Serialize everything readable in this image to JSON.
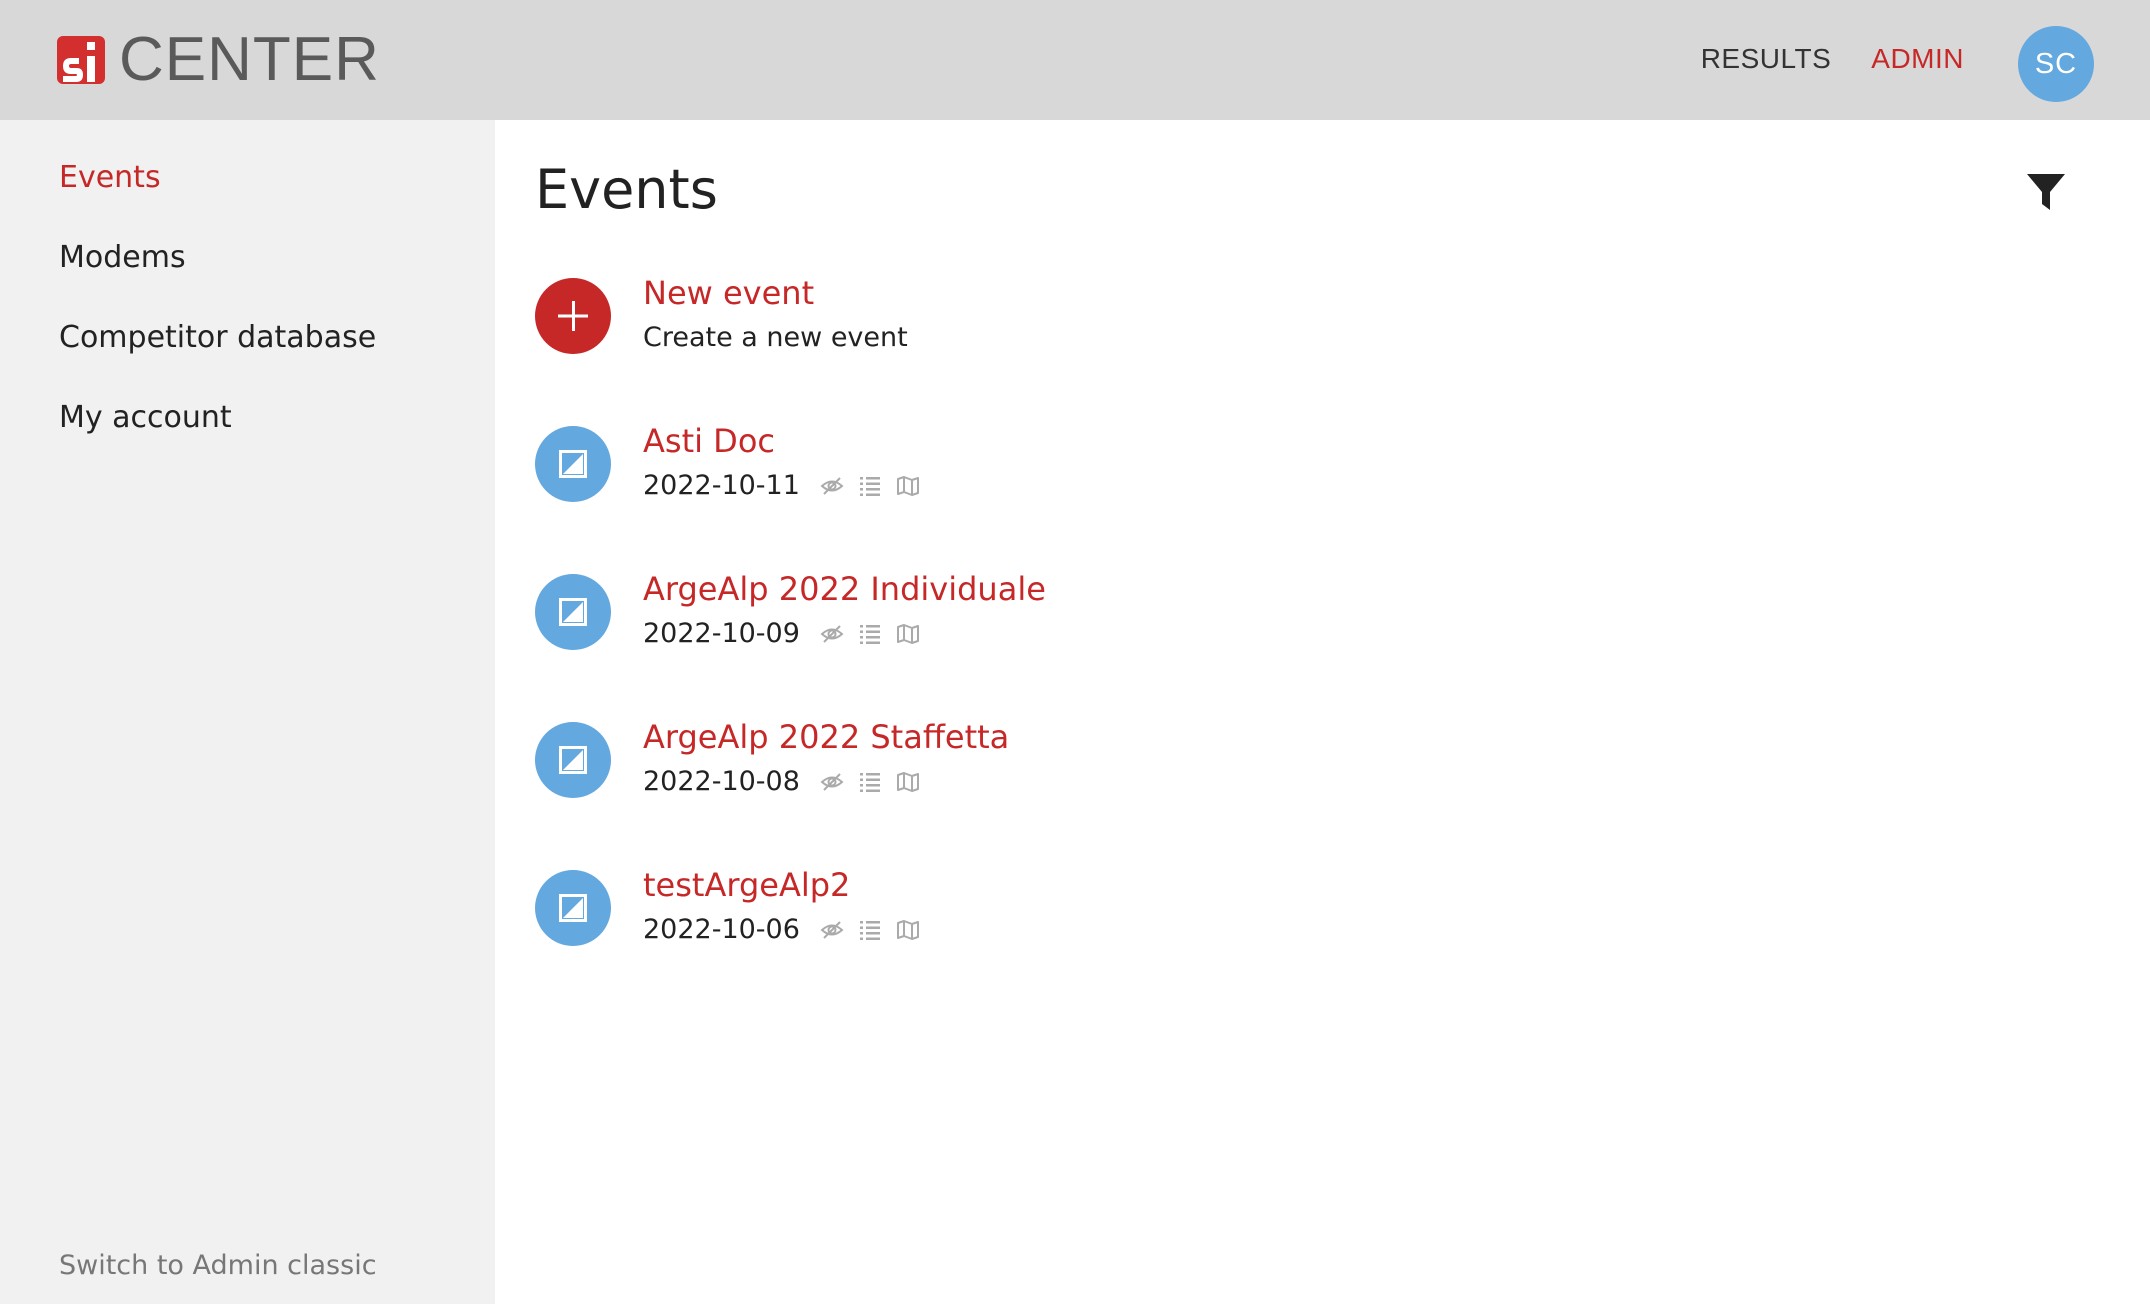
{
  "header": {
    "logo_text": "CENTER",
    "nav": [
      {
        "label": "RESULTS",
        "active": false
      },
      {
        "label": "ADMIN",
        "active": true
      }
    ],
    "avatar_initials": "SC"
  },
  "sidebar": {
    "items": [
      {
        "label": "Events",
        "active": true
      },
      {
        "label": "Modems",
        "active": false
      },
      {
        "label": "Competitor database",
        "active": false
      },
      {
        "label": "My account",
        "active": false
      }
    ],
    "bottom_link": "Switch to Admin classic"
  },
  "main": {
    "title": "Events",
    "new_event": {
      "title": "New event",
      "subtitle": "Create a new event",
      "icon": "plus-icon"
    },
    "events": [
      {
        "name": "Asti Doc",
        "date": "2022-10-11"
      },
      {
        "name": "ArgeAlp 2022 Individuale",
        "date": "2022-10-09"
      },
      {
        "name": "ArgeAlp 2022 Staffetta",
        "date": "2022-10-08"
      },
      {
        "name": "testArgeAlp2",
        "date": "2022-10-06"
      }
    ]
  },
  "colors": {
    "accent": "#c62828",
    "header_bg": "#d8d8d8",
    "sidebar_bg": "#f1f1f1",
    "avatar_bg": "#64a8e0"
  }
}
